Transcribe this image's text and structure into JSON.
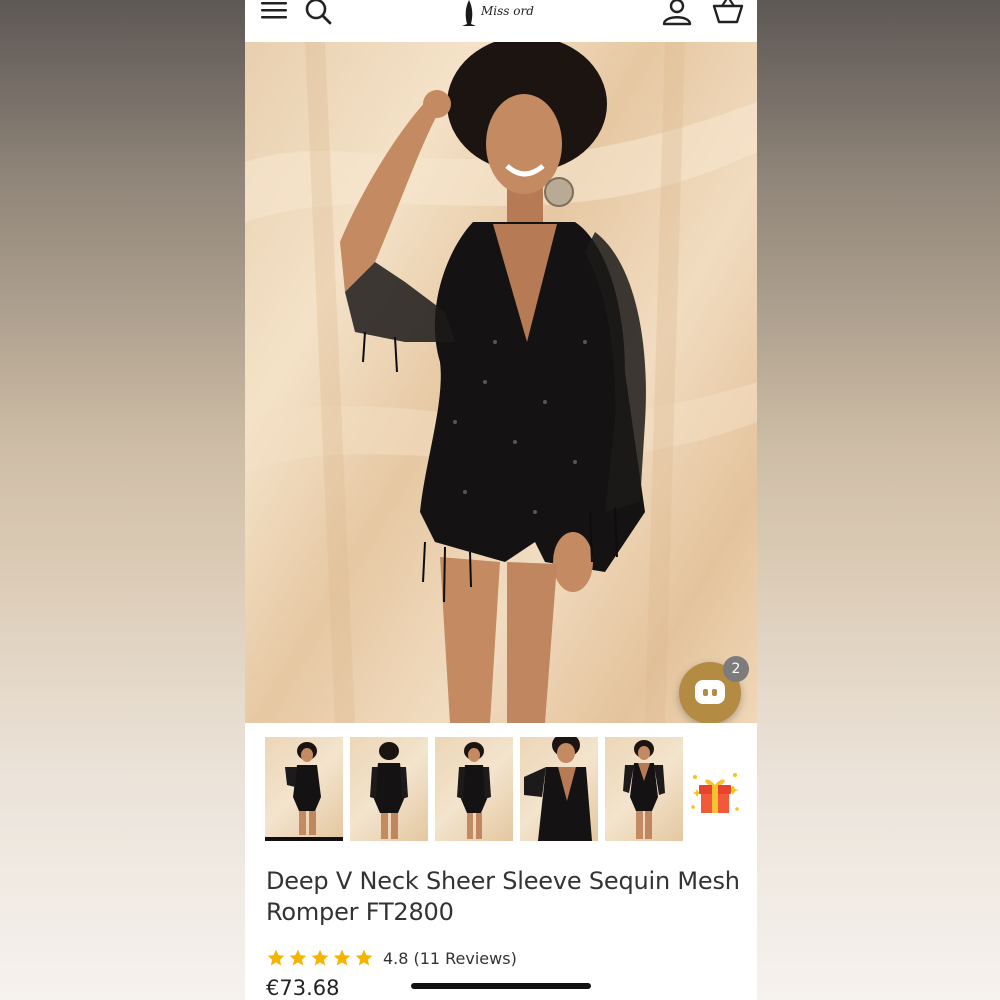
{
  "header": {
    "brand": "Miss ord",
    "icons": [
      "menu-icon",
      "search-icon",
      "account-icon",
      "cart-icon"
    ]
  },
  "chat": {
    "badge_count": "2",
    "accent_color": "#b38b43"
  },
  "thumbnails": {
    "count": 5,
    "active_index": 0,
    "extra_icon": "gift-box-icon"
  },
  "product": {
    "title": "Deep V Neck Sheer Sleeve Sequin Mesh Romper FT2800",
    "rating": 4.8,
    "rating_label": "4.8",
    "reviews_label": "(11 Reviews)",
    "price": "€73.68",
    "star_color": "#f5b400"
  }
}
